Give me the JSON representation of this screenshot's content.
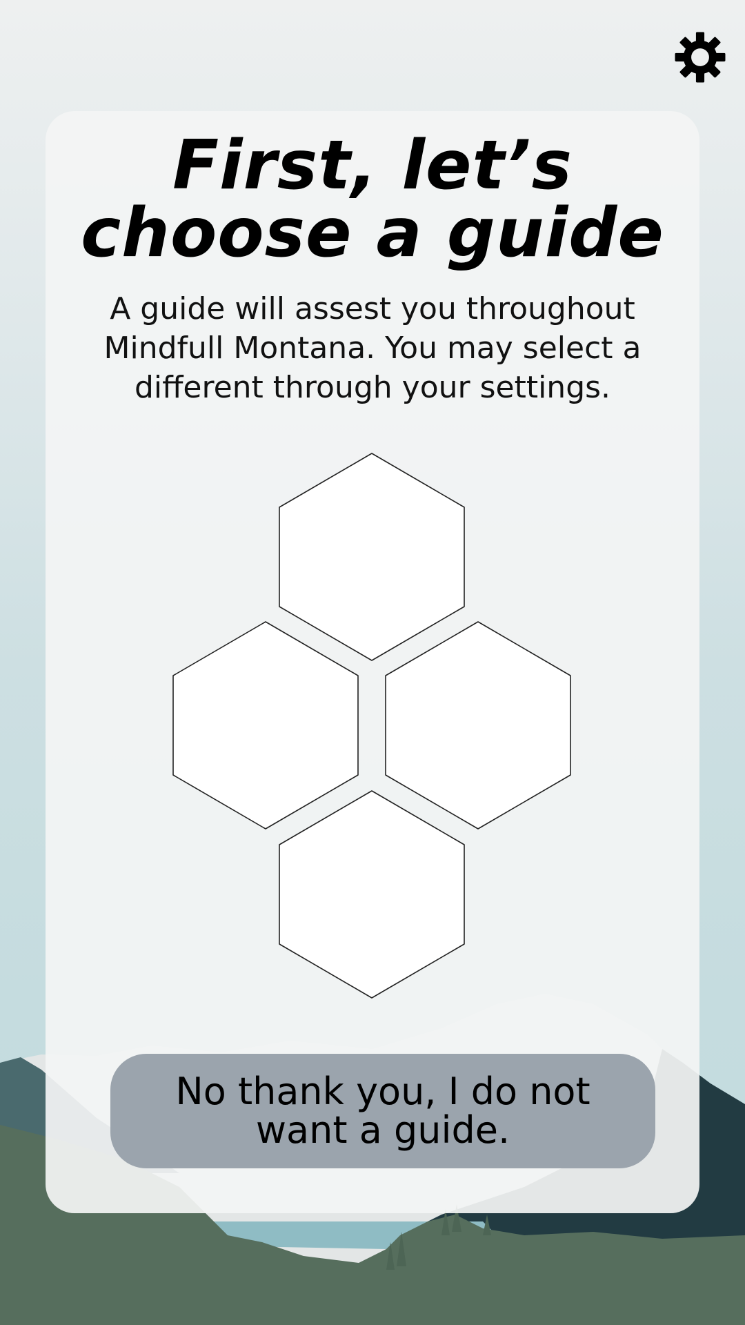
{
  "header": {
    "settings_icon": "gear-icon"
  },
  "onboarding": {
    "title": "First, let’s choose a guide",
    "description": "A guide will assest you throughout Mindfull Montana. You may select a different through your settings.",
    "guide_options": [
      {
        "slot": "top"
      },
      {
        "slot": "left"
      },
      {
        "slot": "right"
      },
      {
        "slot": "bottom"
      }
    ],
    "decline_label": "No thank you, I do not want a guide."
  },
  "colors": {
    "card_background": "#f3f4f4",
    "decline_button": "#9ba4ad",
    "forest": "#566e5d",
    "mountain_dark": "#223b42",
    "lake": "#8fbcc4"
  }
}
